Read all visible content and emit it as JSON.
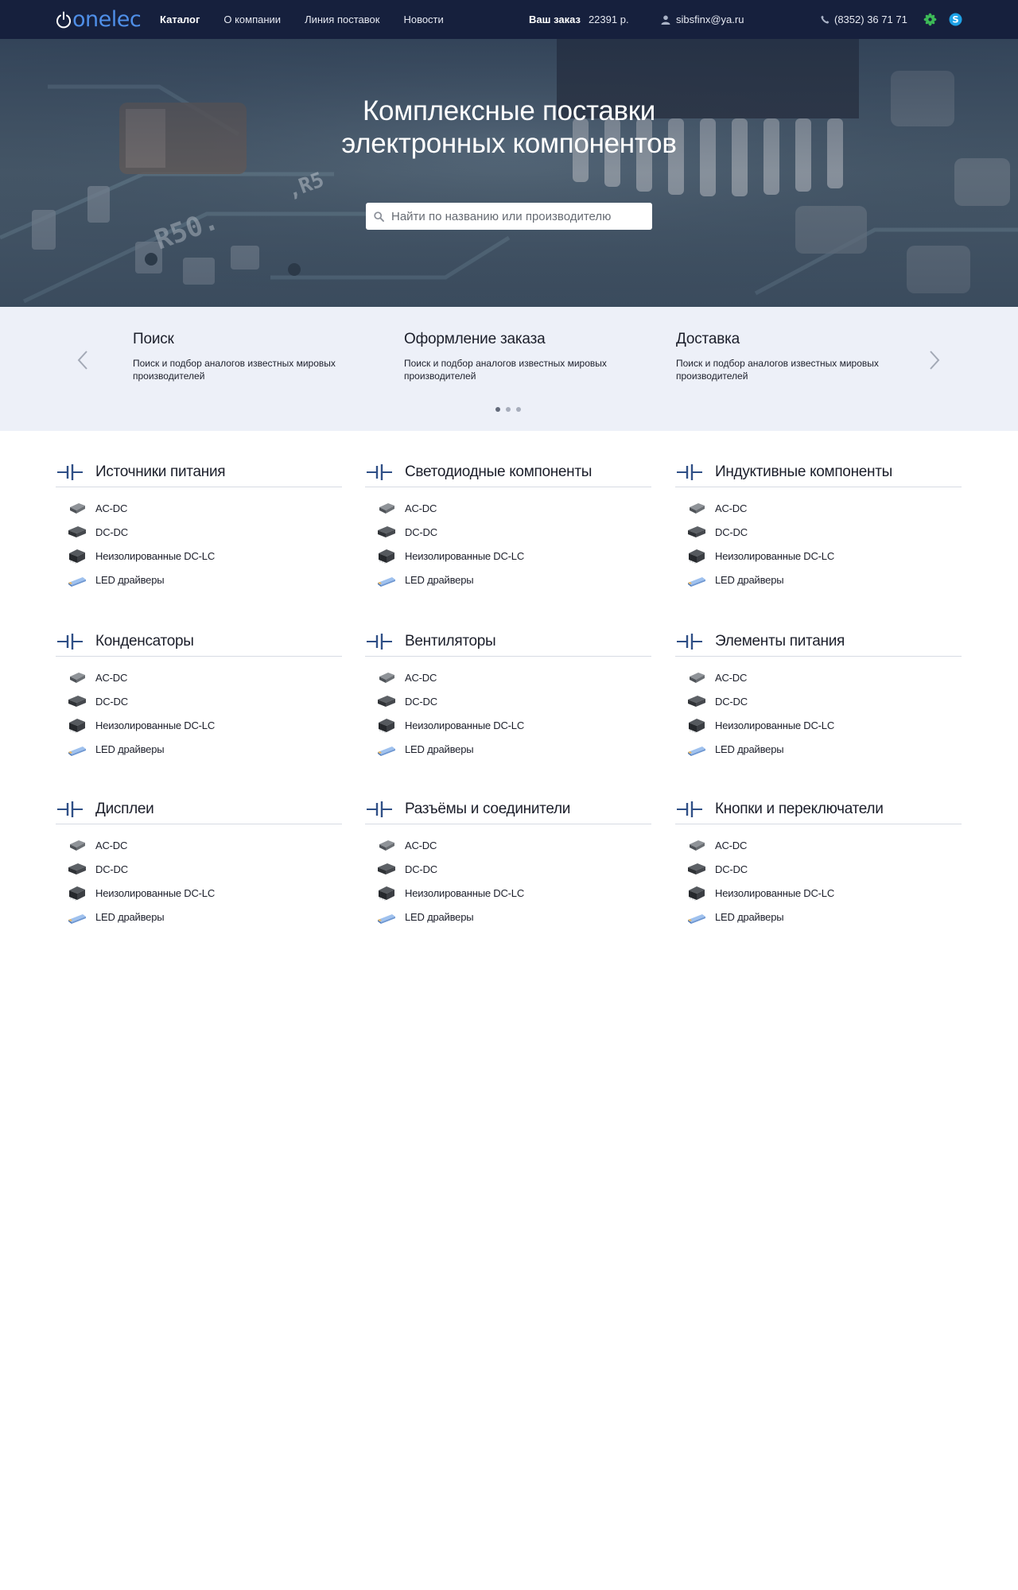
{
  "header": {
    "logo": "onelec",
    "nav": [
      {
        "label": "Каталог",
        "active": true
      },
      {
        "label": "О компании",
        "active": false
      },
      {
        "label": "Линия поставок",
        "active": false
      },
      {
        "label": "Новости",
        "active": false
      }
    ],
    "order_label": "Ваш заказ",
    "order_sum": "22391 р.",
    "user_email": "sibsfinx@ya.ru",
    "phone": "(8352) 36 71 71",
    "icons": [
      "user-icon",
      "phone-icon",
      "messenger-icon",
      "skype-icon"
    ],
    "colors": {
      "bar": "#16203d",
      "logo": "#4f8fe8",
      "messenger": "#3dbb57",
      "skype": "#1da1e6"
    }
  },
  "hero": {
    "title_line1": "Комплексные поставки",
    "title_line2": "электронных компонентов",
    "search_placeholder": "Найти по названию или производителю"
  },
  "features": {
    "items": [
      {
        "title": "Поиск",
        "text": "Поиск и подбор аналогов известных мировых производителей"
      },
      {
        "title": "Оформление заказа",
        "text": "Поиск и подбор аналогов известных мировых производителей"
      },
      {
        "title": "Доставка",
        "text": "Поиск и подбор аналогов известных мировых производителей"
      }
    ],
    "active_slide": 1,
    "slides_total": 3
  },
  "catalog": {
    "categories": [
      {
        "title": "Источники питания",
        "items": [
          "AC-DC",
          "DC-DC",
          "Неизолированные DC-LC",
          "LED драйверы"
        ]
      },
      {
        "title": "Светодиодные компоненты",
        "items": [
          "AC-DC",
          "DC-DC",
          "Неизолированные DC-LC",
          "LED драйверы"
        ]
      },
      {
        "title": "Индуктивные компоненты",
        "items": [
          "AC-DC",
          "DC-DC",
          "Неизолированные DC-LC",
          "LED драйверы"
        ]
      },
      {
        "title": "Конденсаторы",
        "items": [
          "AC-DC",
          "DC-DC",
          "Неизолированные DC-LC",
          "LED драйверы"
        ]
      },
      {
        "title": "Вентиляторы",
        "items": [
          "AC-DC",
          "DC-DC",
          "Неизолированные DC-LC",
          "LED драйверы"
        ]
      },
      {
        "title": "Элементы питания",
        "items": [
          "AC-DC",
          "DC-DC",
          "Неизолированные DC-LC",
          "LED драйверы"
        ]
      },
      {
        "title": "Дисплеи",
        "items": [
          "AC-DC",
          "DC-DC",
          "Неизолированные DC-LC",
          "LED драйверы"
        ]
      },
      {
        "title": "Разъёмы и соединители",
        "items": [
          "AC-DC",
          "DC-DC",
          "Неизолированные DC-LC",
          "LED драйверы"
        ]
      },
      {
        "title": "Кнопки и переключатели",
        "items": [
          "AC-DC",
          "DC-DC",
          "Неизолированные DC-LC",
          "LED драйверы"
        ]
      }
    ],
    "accent_color": "#2f4f86"
  }
}
